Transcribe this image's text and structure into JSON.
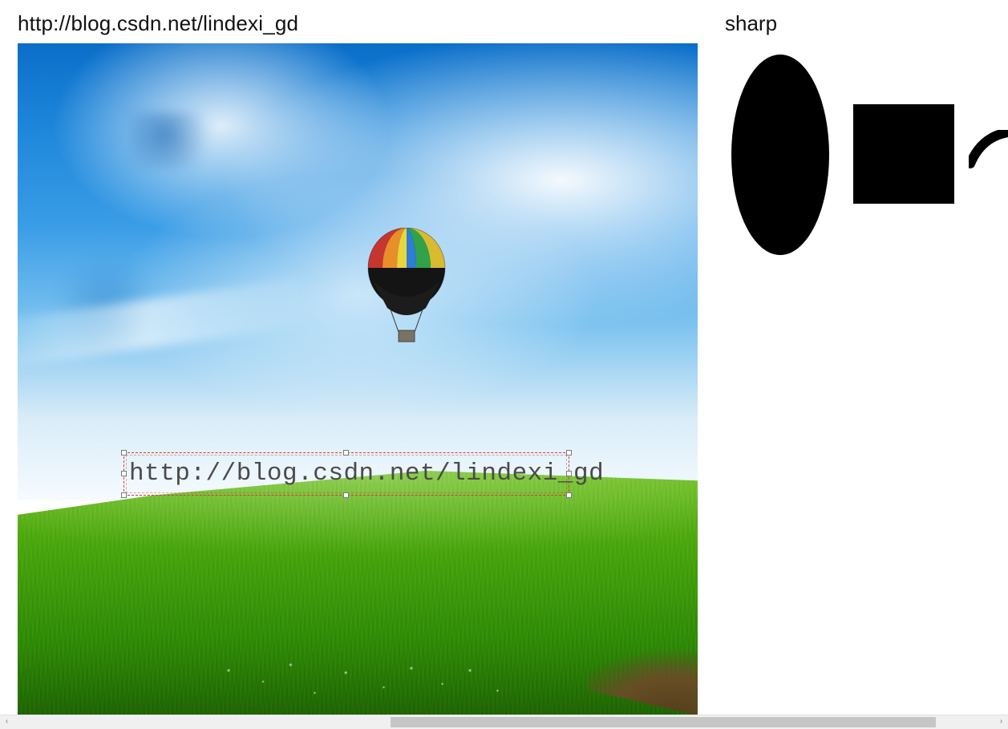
{
  "header": {
    "title": "http://blog.csdn.net/lindexi_gd",
    "panel_label": "sharp"
  },
  "canvas": {
    "watermark_text": "http://blog.csdn.net/lindexi_gd"
  },
  "shapes": {
    "ellipse_name": "ellipse-shape",
    "rect_name": "rectangle-shape",
    "curve_name": "curve-shape"
  },
  "scrollbar": {
    "left_glyph": "‹",
    "right_glyph": "›"
  }
}
